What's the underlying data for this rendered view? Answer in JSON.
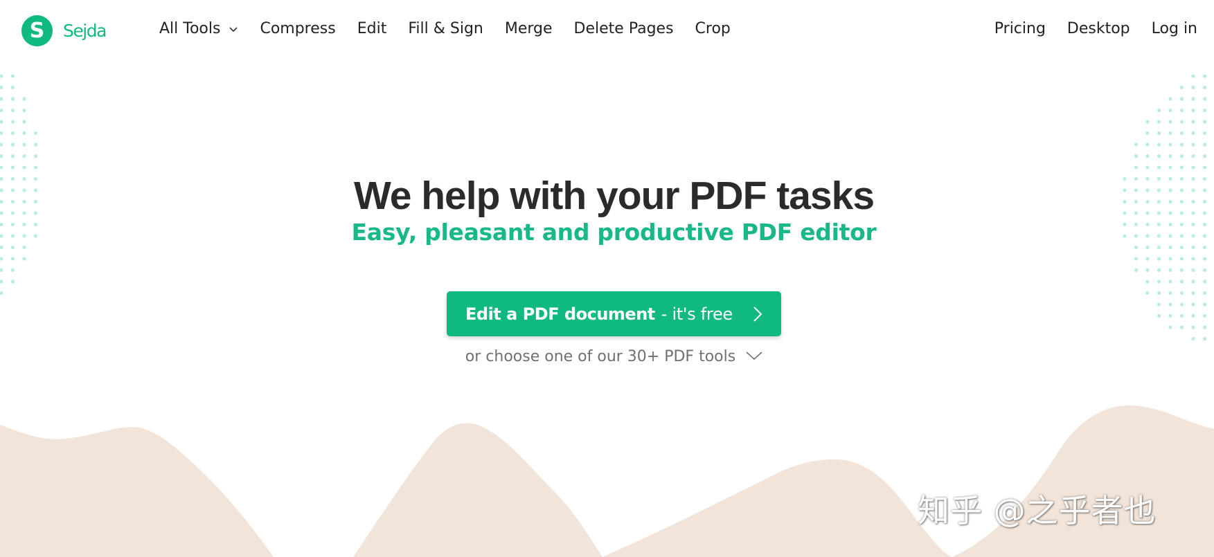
{
  "header": {
    "logo_text": "Sejda",
    "logo_letter": "S",
    "nav_left": [
      {
        "label": "All Tools",
        "has_dropdown": true
      },
      {
        "label": "Compress"
      },
      {
        "label": "Edit"
      },
      {
        "label": "Fill & Sign"
      },
      {
        "label": "Merge"
      },
      {
        "label": "Delete Pages"
      },
      {
        "label": "Crop"
      }
    ],
    "nav_right": [
      {
        "label": "Pricing"
      },
      {
        "label": "Desktop"
      },
      {
        "label": "Log in"
      }
    ]
  },
  "hero": {
    "title": "We help with your PDF tasks",
    "subtitle": "Easy, pleasant and productive PDF editor",
    "cta_strong": "Edit a PDF document",
    "cta_light": "- it's free",
    "choose_text": "or choose one of our 30+ PDF tools"
  },
  "watermark": "知乎 @之乎者也",
  "colors": {
    "brand": "#10b981",
    "subtitle": "#18b888",
    "dots": "#b8eedb",
    "wave": "#f2e4d8",
    "muted_text": "#707070"
  },
  "icons": {
    "logo": "sejda-logo-icon",
    "all_tools_dropdown": "chevron-down-icon",
    "cta_arrow": "chevron-right-icon",
    "choose_arrow": "chevron-down-icon"
  }
}
